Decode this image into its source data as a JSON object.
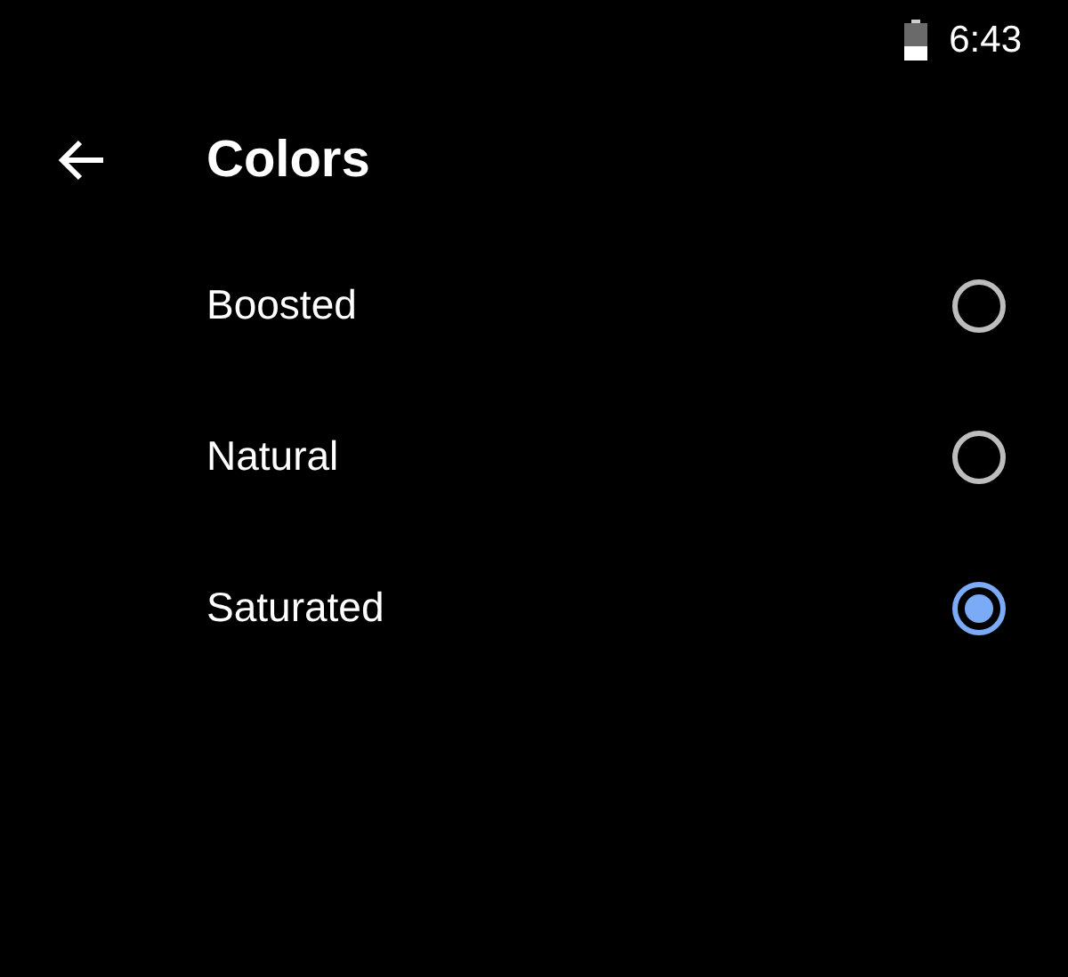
{
  "status_bar": {
    "time": "6:43"
  },
  "header": {
    "title": "Colors"
  },
  "options": [
    {
      "label": "Boosted",
      "selected": false
    },
    {
      "label": "Natural",
      "selected": false
    },
    {
      "label": "Saturated",
      "selected": true
    }
  ]
}
